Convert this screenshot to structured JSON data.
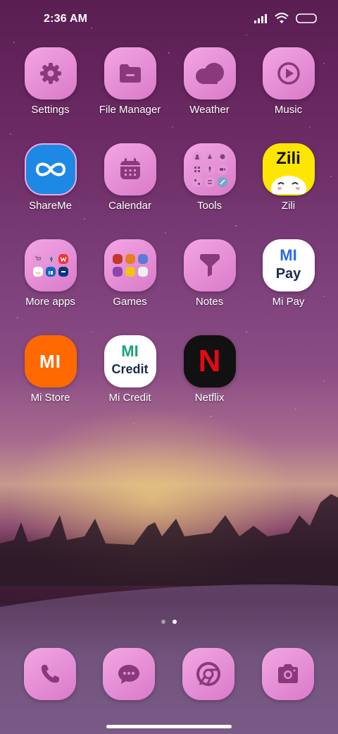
{
  "status_bar": {
    "time": "2:36 AM"
  },
  "apps": [
    {
      "label": "Settings",
      "icon": "settings-icon"
    },
    {
      "label": "File Manager",
      "icon": "folder-icon"
    },
    {
      "label": "Weather",
      "icon": "cloud-icon"
    },
    {
      "label": "Music",
      "icon": "play-icon"
    },
    {
      "label": "ShareMe",
      "icon": "infinity-icon"
    },
    {
      "label": "Calendar",
      "icon": "calendar-icon"
    },
    {
      "label": "Tools",
      "icon": "tools-folder-icon"
    },
    {
      "label": "Zili",
      "icon": "zili-logo"
    },
    {
      "label": "More apps",
      "icon": "more-apps-folder-icon"
    },
    {
      "label": "Games",
      "icon": "games-folder-icon"
    },
    {
      "label": "Notes",
      "icon": "notes-icon"
    },
    {
      "label": "Mi Pay",
      "icon": "mi-pay-logo"
    },
    {
      "label": "Mi Store",
      "icon": "mi-store-logo"
    },
    {
      "label": "Mi Credit",
      "icon": "mi-credit-logo"
    },
    {
      "label": "Netflix",
      "icon": "netflix-logo"
    }
  ],
  "logos": {
    "zili": "Zili",
    "mi_pay_top": "MI",
    "mi_pay_bottom": "Pay",
    "mi_store": "MI",
    "mi_credit_top": "MI",
    "mi_credit_bottom": "Credit",
    "netflix": "N"
  },
  "dock": [
    {
      "icon": "phone-icon"
    },
    {
      "icon": "messaging-icon"
    },
    {
      "icon": "chrome-icon"
    },
    {
      "icon": "camera-icon"
    }
  ],
  "page_indicator": {
    "pages": 2,
    "current": 2
  },
  "colors": {
    "icon_pink": "#e78ad6",
    "glyph": "#8a3a7c",
    "shareme_blue": "#1e88e5",
    "zili_yellow": "#ffe600",
    "mi_orange": "#ff6900",
    "mi_credit_green": "#1aa37a",
    "mi_pay_blue": "#2a6de0",
    "netflix_red": "#e50914"
  }
}
